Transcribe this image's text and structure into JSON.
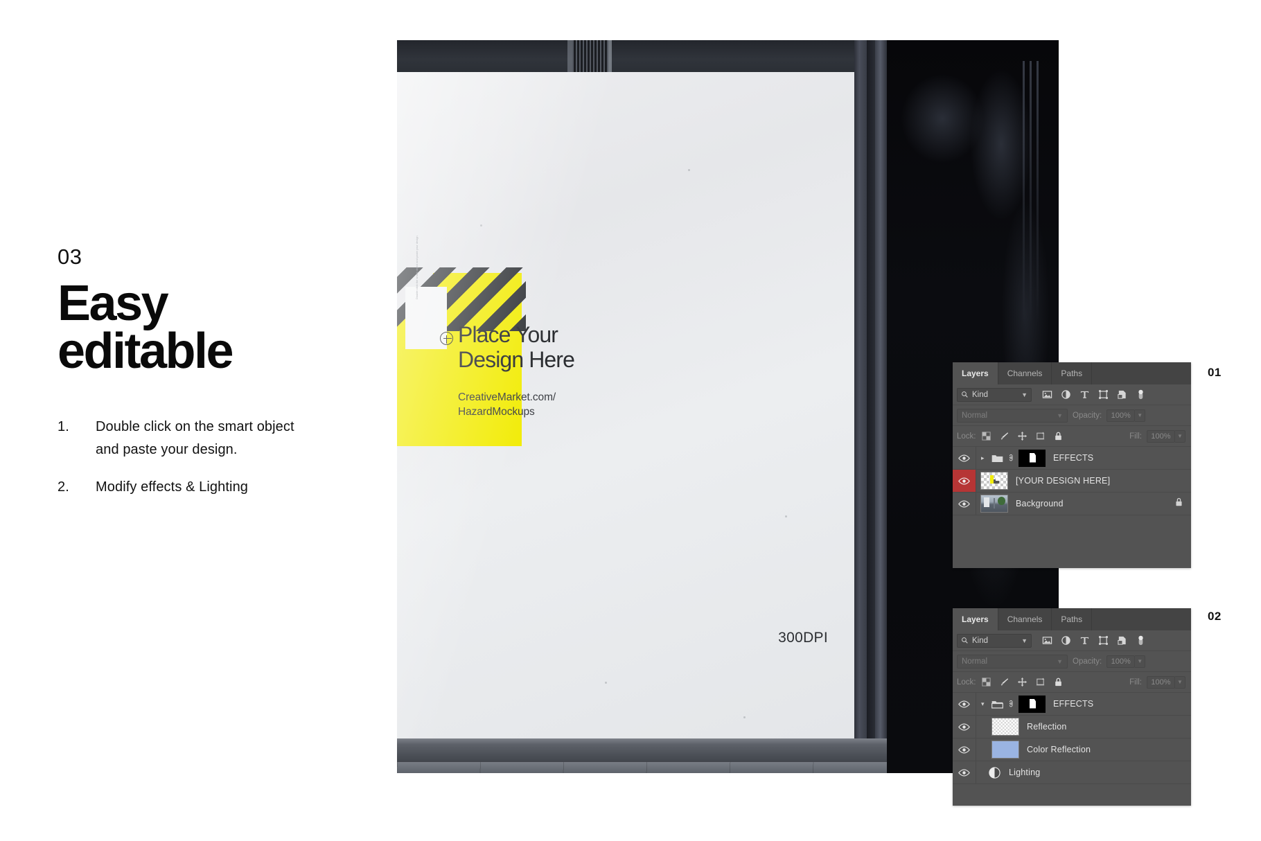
{
  "left": {
    "step_number": "03",
    "headline": "Easy\neditable",
    "steps": [
      {
        "index": "1.",
        "text": "Double click on the smart object and paste your design."
      },
      {
        "index": "2.",
        "text": "Modify effects & Lighting"
      }
    ]
  },
  "poster": {
    "title": "Place Your\nDesign Here",
    "url": "CreativeMarket.com/\nHazardMockups",
    "dpi": "300DPI",
    "vertical_card_text": "Double click the smart object and paste your design",
    "colors": {
      "yellow": "#F2EC0B",
      "stripe": "#34373B",
      "text": "#2B2D31"
    }
  },
  "panels": [
    {
      "tag": "01",
      "tabs": [
        {
          "label": "Layers",
          "active": true
        },
        {
          "label": "Channels",
          "active": false
        },
        {
          "label": "Paths",
          "active": false
        }
      ],
      "filter": {
        "kind_label": "Kind"
      },
      "blend": {
        "mode": "Normal",
        "opacity_label": "Opacity:",
        "opacity_value": "100%"
      },
      "lock": {
        "label": "Lock:",
        "fill_label": "Fill:",
        "fill_value": "100%"
      },
      "layers": [
        {
          "name": "EFFECTS",
          "type": "group",
          "expanded": false,
          "visible": true,
          "selected": false,
          "locked": false
        },
        {
          "name": "[YOUR DESIGN HERE]",
          "type": "smart-object",
          "visible": true,
          "selected": true,
          "locked": false
        },
        {
          "name": "Background",
          "type": "image",
          "visible": true,
          "selected": false,
          "locked": true
        }
      ]
    },
    {
      "tag": "02",
      "tabs": [
        {
          "label": "Layers",
          "active": true
        },
        {
          "label": "Channels",
          "active": false
        },
        {
          "label": "Paths",
          "active": false
        }
      ],
      "filter": {
        "kind_label": "Kind"
      },
      "blend": {
        "mode": "Normal",
        "opacity_label": "Opacity:",
        "opacity_value": "100%"
      },
      "lock": {
        "label": "Lock:",
        "fill_label": "Fill:",
        "fill_value": "100%"
      },
      "layers": [
        {
          "name": "EFFECTS",
          "type": "group",
          "expanded": true,
          "visible": true,
          "selected": false,
          "locked": false
        },
        {
          "name": "Reflection",
          "type": "pixel",
          "visible": true,
          "selected": false,
          "locked": false
        },
        {
          "name": "Color Reflection",
          "type": "fill",
          "visible": true,
          "selected": false,
          "locked": false
        },
        {
          "name": "Lighting",
          "type": "adjustment",
          "visible": true,
          "selected": false,
          "locked": false
        }
      ]
    }
  ],
  "theme": {
    "panel_bg": "#535353",
    "panel_header": "#444444",
    "selection_red": "#B63535",
    "accent_yellow": "#F2EC0B"
  }
}
